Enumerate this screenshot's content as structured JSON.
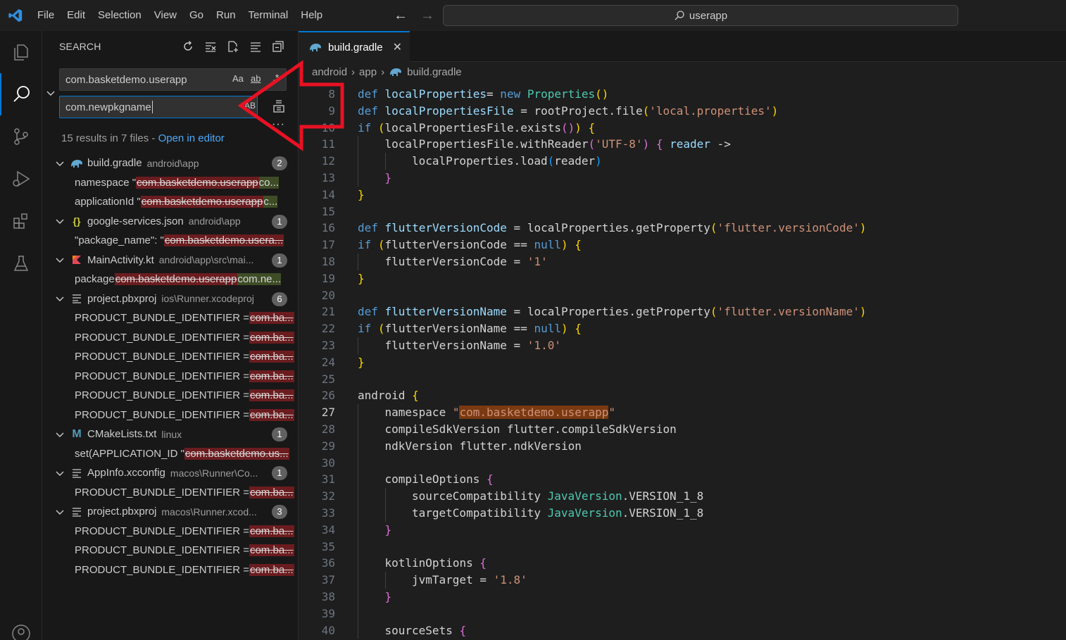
{
  "menu": [
    "File",
    "Edit",
    "Selection",
    "View",
    "Go",
    "Run",
    "Terminal",
    "Help"
  ],
  "command_center": {
    "text": "userapp"
  },
  "sidebar": {
    "title": "SEARCH",
    "search_value": "com.basketdemo.userapp",
    "search_options": {
      "case": "Aa",
      "word": "ab"
    },
    "replace_value": "com.newpkgname",
    "preserve_case": "AB",
    "summary": "15 results in 7 files - ",
    "open_in_editor": "Open in editor",
    "files": [
      {
        "name": "build.gradle",
        "path": "android\\app",
        "count": "2",
        "icon": "gradle-elephant-icon",
        "matches": [
          {
            "pre": "namespace \"",
            "old": "com.basketdemo.userapp",
            "new": "co..."
          },
          {
            "pre": "applicationId \"",
            "old": "com.basketdemo.userapp",
            "new": "c..."
          }
        ]
      },
      {
        "name": "google-services.json",
        "path": "android\\app",
        "count": "1",
        "icon": "json-braces-icon",
        "matches": [
          {
            "pre": "\"package_name\": \"",
            "old": "com.basketdemo.usera...",
            "new": ""
          }
        ]
      },
      {
        "name": "MainActivity.kt",
        "path": "android\\app\\src\\mai...",
        "count": "1",
        "icon": "kotlin-icon",
        "matches": [
          {
            "pre": "package ",
            "old": "com.basketdemo.userapp",
            "new": "com.ne..."
          }
        ]
      },
      {
        "name": "project.pbxproj",
        "path": "ios\\Runner.xcodeproj",
        "count": "6",
        "icon": "lines-file-icon",
        "matches": [
          {
            "pre": "PRODUCT_BUNDLE_IDENTIFIER = ",
            "old": "com.ba...",
            "new": ""
          },
          {
            "pre": "PRODUCT_BUNDLE_IDENTIFIER = ",
            "old": "com.ba...",
            "new": ""
          },
          {
            "pre": "PRODUCT_BUNDLE_IDENTIFIER = ",
            "old": "com.ba...",
            "new": ""
          },
          {
            "pre": "PRODUCT_BUNDLE_IDENTIFIER = ",
            "old": "com.ba...",
            "new": ""
          },
          {
            "pre": "PRODUCT_BUNDLE_IDENTIFIER = ",
            "old": "com.ba...",
            "new": ""
          },
          {
            "pre": "PRODUCT_BUNDLE_IDENTIFIER = ",
            "old": "com.ba...",
            "new": ""
          }
        ]
      },
      {
        "name": "CMakeLists.txt",
        "path": "linux",
        "count": "1",
        "icon": "cmake-m-icon",
        "matches": [
          {
            "pre": "set(APPLICATION_ID \"",
            "old": "com.basketdemo.us...",
            "new": ""
          }
        ]
      },
      {
        "name": "AppInfo.xcconfig",
        "path": "macos\\Runner\\Co...",
        "count": "1",
        "icon": "lines-file-icon",
        "matches": [
          {
            "pre": "PRODUCT_BUNDLE_IDENTIFIER = ",
            "old": "com.ba...",
            "new": ""
          }
        ]
      },
      {
        "name": "project.pbxproj",
        "path": "macos\\Runner.xcod...",
        "count": "3",
        "icon": "lines-file-icon",
        "matches": [
          {
            "pre": "PRODUCT_BUNDLE_IDENTIFIER = ",
            "old": "com.ba...",
            "new": ""
          },
          {
            "pre": "PRODUCT_BUNDLE_IDENTIFIER = ",
            "old": "com.ba...",
            "new": ""
          },
          {
            "pre": "PRODUCT_BUNDLE_IDENTIFIER = ",
            "old": "com.ba...",
            "new": ""
          }
        ]
      }
    ]
  },
  "editor": {
    "tab": "build.gradle",
    "breadcrumb": [
      "android",
      "app",
      "build.gradle"
    ],
    "current_line": 27,
    "lines": [
      {
        "n": 8,
        "indent": 0,
        "t": [
          [
            "kw",
            "def "
          ],
          [
            "vr",
            "localProperties"
          ],
          [
            "",
            "="
          ],
          [
            "kw",
            " new "
          ],
          [
            "ty",
            "Properties"
          ],
          [
            "br1",
            "()"
          ]
        ]
      },
      {
        "n": 9,
        "indent": 0,
        "t": [
          [
            "kw",
            "def "
          ],
          [
            "vr",
            "localPropertiesFile"
          ],
          [
            "",
            " = rootProject.file"
          ],
          [
            "br1",
            "("
          ],
          [
            "st",
            "'local.properties'"
          ],
          [
            "br1",
            ")"
          ]
        ]
      },
      {
        "n": 10,
        "indent": 0,
        "t": [
          [
            "kw",
            "if "
          ],
          [
            "br1",
            "("
          ],
          [
            "",
            "localPropertiesFile.exists"
          ],
          [
            "br2",
            "()"
          ],
          [
            "br1",
            ")"
          ],
          [
            "",
            " "
          ],
          [
            "br1",
            "{"
          ]
        ]
      },
      {
        "n": 11,
        "indent": 1,
        "t": [
          [
            "",
            "localPropertiesFile.withReader"
          ],
          [
            "br2",
            "("
          ],
          [
            "st",
            "'UTF-8'"
          ],
          [
            "br2",
            ")"
          ],
          [
            "",
            " "
          ],
          [
            "br2",
            "{"
          ],
          [
            "",
            " "
          ],
          [
            "vr",
            "reader"
          ],
          [
            "",
            " ->"
          ]
        ]
      },
      {
        "n": 12,
        "indent": 2,
        "t": [
          [
            "",
            "localProperties.load"
          ],
          [
            "br3",
            "("
          ],
          [
            "",
            "reader"
          ],
          [
            "br3",
            ")"
          ]
        ]
      },
      {
        "n": 13,
        "indent": 1,
        "t": [
          [
            "br2",
            "}"
          ]
        ]
      },
      {
        "n": 14,
        "indent": 0,
        "t": [
          [
            "br1",
            "}"
          ]
        ]
      },
      {
        "n": 15,
        "indent": 0,
        "t": []
      },
      {
        "n": 16,
        "indent": 0,
        "t": [
          [
            "kw",
            "def "
          ],
          [
            "vr",
            "flutterVersionCode"
          ],
          [
            "",
            " = localProperties.getProperty"
          ],
          [
            "br1",
            "("
          ],
          [
            "st",
            "'flutter.versionCode'"
          ],
          [
            "br1",
            ")"
          ]
        ]
      },
      {
        "n": 17,
        "indent": 0,
        "t": [
          [
            "kw",
            "if "
          ],
          [
            "br1",
            "("
          ],
          [
            "",
            "flutterVersionCode == "
          ],
          [
            "kw",
            "null"
          ],
          [
            "br1",
            ")"
          ],
          [
            "",
            " "
          ],
          [
            "br1",
            "{"
          ]
        ]
      },
      {
        "n": 18,
        "indent": 1,
        "t": [
          [
            "",
            "flutterVersionCode = "
          ],
          [
            "st",
            "'1'"
          ]
        ]
      },
      {
        "n": 19,
        "indent": 0,
        "t": [
          [
            "br1",
            "}"
          ]
        ]
      },
      {
        "n": 20,
        "indent": 0,
        "t": []
      },
      {
        "n": 21,
        "indent": 0,
        "t": [
          [
            "kw",
            "def "
          ],
          [
            "vr",
            "flutterVersionName"
          ],
          [
            "",
            " = localProperties.getProperty"
          ],
          [
            "br1",
            "("
          ],
          [
            "st",
            "'flutter.versionName'"
          ],
          [
            "br1",
            ")"
          ]
        ]
      },
      {
        "n": 22,
        "indent": 0,
        "t": [
          [
            "kw",
            "if "
          ],
          [
            "br1",
            "("
          ],
          [
            "",
            "flutterVersionName == "
          ],
          [
            "kw",
            "null"
          ],
          [
            "br1",
            ")"
          ],
          [
            "",
            " "
          ],
          [
            "br1",
            "{"
          ]
        ]
      },
      {
        "n": 23,
        "indent": 1,
        "t": [
          [
            "",
            "flutterVersionName = "
          ],
          [
            "st",
            "'1.0'"
          ]
        ]
      },
      {
        "n": 24,
        "indent": 0,
        "t": [
          [
            "br1",
            "}"
          ]
        ]
      },
      {
        "n": 25,
        "indent": 0,
        "t": []
      },
      {
        "n": 26,
        "indent": 0,
        "t": [
          [
            "",
            "android "
          ],
          [
            "br1",
            "{"
          ]
        ]
      },
      {
        "n": 27,
        "indent": 1,
        "t": [
          [
            "",
            "namespace "
          ],
          [
            "st",
            "\""
          ],
          [
            "hl",
            "com.basketdemo.userapp"
          ],
          [
            "st",
            "\""
          ]
        ]
      },
      {
        "n": 28,
        "indent": 1,
        "t": [
          [
            "",
            "compileSdkVersion flutter.compileSdkVersion"
          ]
        ]
      },
      {
        "n": 29,
        "indent": 1,
        "t": [
          [
            "",
            "ndkVersion flutter.ndkVersion"
          ]
        ]
      },
      {
        "n": 30,
        "indent": 1,
        "t": []
      },
      {
        "n": 31,
        "indent": 1,
        "t": [
          [
            "",
            "compileOptions "
          ],
          [
            "br2",
            "{"
          ]
        ]
      },
      {
        "n": 32,
        "indent": 2,
        "t": [
          [
            "",
            "sourceCompatibility "
          ],
          [
            "ty",
            "JavaVersion"
          ],
          [
            "",
            ".VERSION_1_8"
          ]
        ]
      },
      {
        "n": 33,
        "indent": 2,
        "t": [
          [
            "",
            "targetCompatibility "
          ],
          [
            "ty",
            "JavaVersion"
          ],
          [
            "",
            ".VERSION_1_8"
          ]
        ]
      },
      {
        "n": 34,
        "indent": 1,
        "t": [
          [
            "br2",
            "}"
          ]
        ]
      },
      {
        "n": 35,
        "indent": 1,
        "t": []
      },
      {
        "n": 36,
        "indent": 1,
        "t": [
          [
            "",
            "kotlinOptions "
          ],
          [
            "br2",
            "{"
          ]
        ]
      },
      {
        "n": 37,
        "indent": 2,
        "t": [
          [
            "",
            "jvmTarget = "
          ],
          [
            "st",
            "'1.8'"
          ]
        ]
      },
      {
        "n": 38,
        "indent": 1,
        "t": [
          [
            "br2",
            "}"
          ]
        ]
      },
      {
        "n": 39,
        "indent": 1,
        "t": []
      },
      {
        "n": 40,
        "indent": 1,
        "t": [
          [
            "",
            "sourceSets "
          ],
          [
            "br2",
            "{"
          ]
        ]
      }
    ]
  },
  "colors": {
    "accent": "#0078d4",
    "annotation_arrow": "#e81123",
    "removed": "#6b1c1f",
    "inserted": "#3e4d26"
  }
}
